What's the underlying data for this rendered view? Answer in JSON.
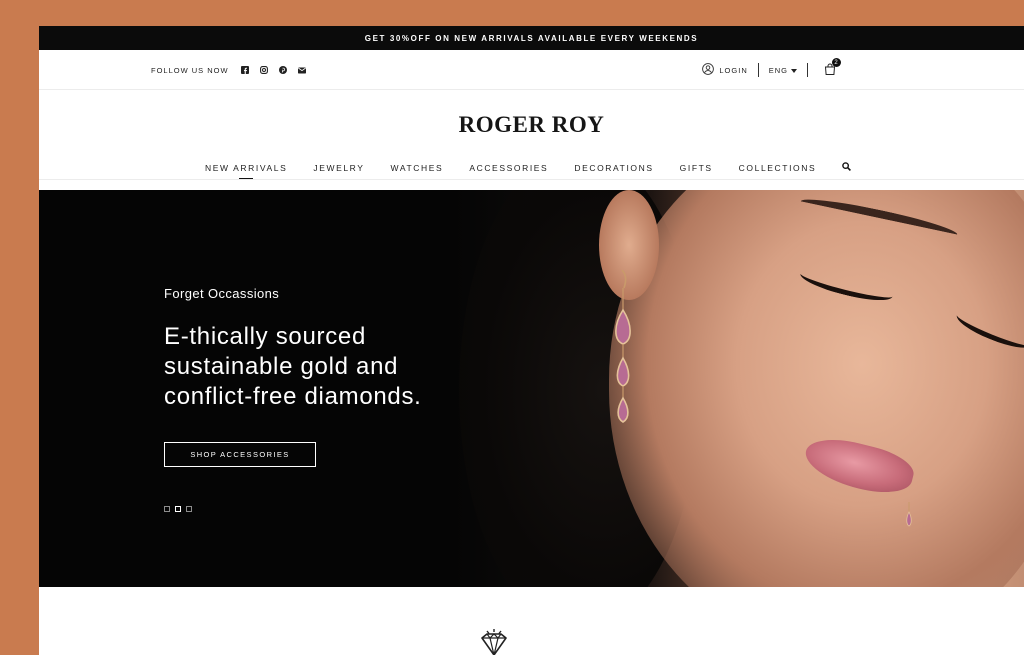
{
  "promo_bar": {
    "text": "GET 30%OFF ON NEW ARRIVALS AVAILABLE EVERY WEEKENDS"
  },
  "utility": {
    "follow_label": "FOLLOW US NOW",
    "social_icons": [
      "facebook-icon",
      "instagram-icon",
      "pinterest-icon",
      "email-icon"
    ],
    "login_label": "LOGIN",
    "language": "ENG",
    "cart_count": "2"
  },
  "brand": {
    "name": "ROGER ROY"
  },
  "nav": {
    "items": [
      {
        "label": "NEW ARRIVALS",
        "active": true
      },
      {
        "label": "JEWELRY"
      },
      {
        "label": "WATCHES"
      },
      {
        "label": "ACCESSORIES"
      },
      {
        "label": "DECORATIONS"
      },
      {
        "label": "GIFTS"
      },
      {
        "label": "COLLECTIONS"
      }
    ],
    "search_icon": "search-icon"
  },
  "hero": {
    "eyebrow": "Forget Occassions",
    "headline": "E-thically sourced sustainable gold and conflict-free diamonds.",
    "cta_label": "SHOP ACCESSORIES",
    "slides": 3,
    "active_slide": 2
  },
  "section_icon": "diamond-icon",
  "colors": {
    "background": "#c97b4f",
    "promo_bg": "#0b0b0b",
    "hero_bg": "#050505"
  }
}
